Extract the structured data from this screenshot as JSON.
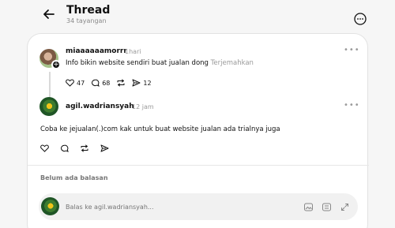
{
  "header": {
    "title": "Thread",
    "subtitle": "34 tayangan"
  },
  "post": {
    "username": "miaaaaaamorrr",
    "time": "1hari",
    "text": "Info bikin website sendiri buat jualan dong",
    "translate": "Terjemahkan",
    "likes": "47",
    "comments": "68",
    "shares": "12"
  },
  "reply": {
    "username": "agil.wadriansyah",
    "time": "12 jam",
    "text": "Coba ke jejualan(.)com kak untuk buat website jualan ada trialnya juga"
  },
  "replies_section": {
    "empty_label": "Belum ada balasan"
  },
  "composer": {
    "placeholder": "Balas ke agil.wadriansyah..."
  }
}
